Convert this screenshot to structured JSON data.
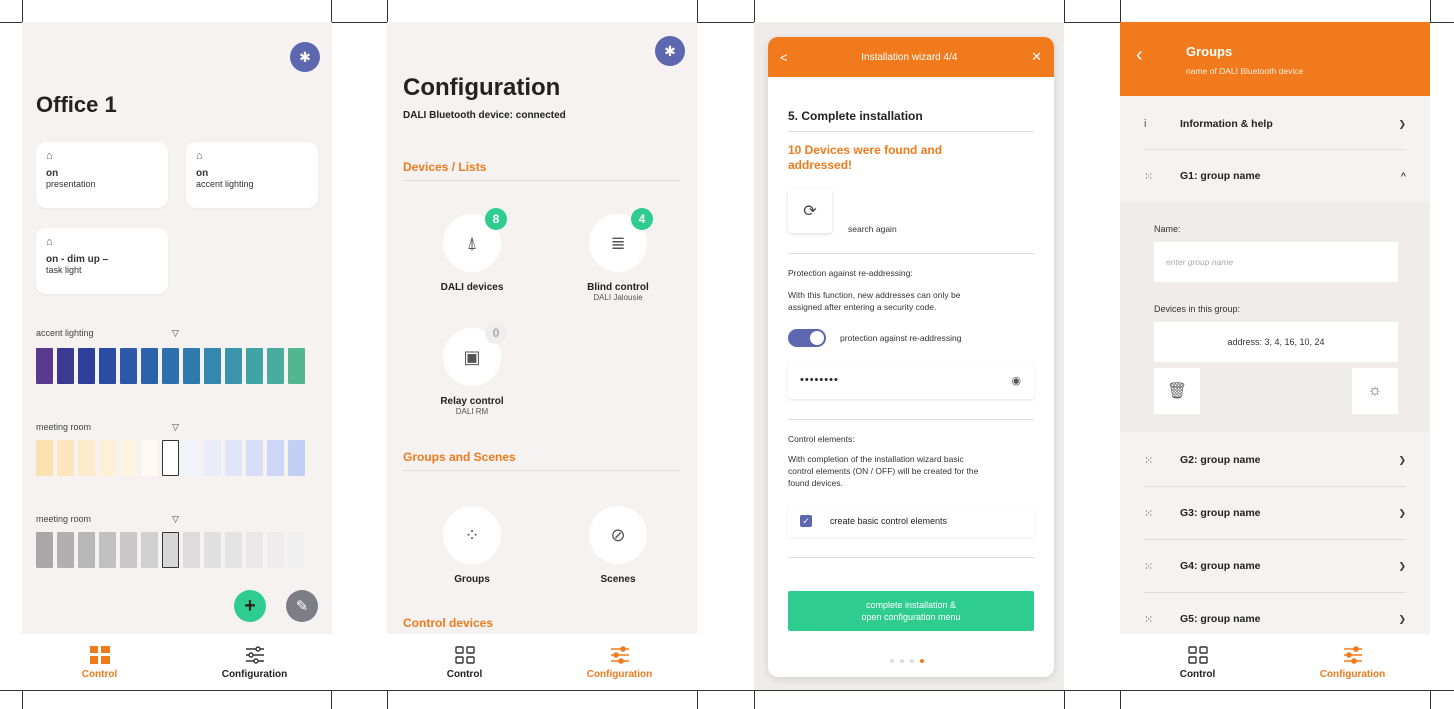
{
  "colors": {
    "accent": "#f07a1c",
    "green": "#2ecc8e",
    "indigo": "#5c67b0"
  },
  "screen1": {
    "title": "Office 1",
    "cards": [
      {
        "state": "on",
        "label": "presentation"
      },
      {
        "state": "on",
        "label": "accent lighting"
      },
      {
        "state": "on -  dim up –",
        "label": "task light"
      }
    ],
    "scenes": [
      {
        "label": "accent lighting",
        "marker": "▽"
      },
      {
        "label": "meeting room",
        "marker": "▽"
      },
      {
        "label": "meeting room",
        "marker": "▽"
      }
    ],
    "fab_add": "+",
    "fab_edit": "✎",
    "nav": {
      "control": "Control",
      "configuration": "Configuration"
    }
  },
  "screen2": {
    "title": "Configuration",
    "subtitle": "DALI Bluetooth device: connected",
    "sections": {
      "devices": "Devices / Lists",
      "groups": "Groups and Scenes",
      "control": "Control devices"
    },
    "devices": [
      {
        "name": "DALI devices",
        "sub": "",
        "count": "8"
      },
      {
        "name": "Blind control",
        "sub": "DALI Jalousie",
        "count": "4"
      },
      {
        "name": "Relay control",
        "sub": "DALI RM",
        "count": "0"
      }
    ],
    "groups_label": "Groups",
    "scenes_label": "Scenes",
    "nav": {
      "control": "Control",
      "configuration": "Configuration"
    }
  },
  "screen3": {
    "header": "Installation wizard 4/4",
    "back": "<",
    "close": "✕",
    "step": "5. Complete installation",
    "found_line1": "10 Devices were  found and",
    "found_line2": "addressed!",
    "search_again": "search again",
    "protection_title": "Protection against re-addressing:",
    "protection_desc1": "With this function, new addresses can only be",
    "protection_desc2": "assigned after entering a security code.",
    "toggle_label": "protection against re-addressing",
    "password": "••••••••",
    "control_title": "Control elements:",
    "control_desc1": "With completion of the installation wizard basic",
    "control_desc2": "control elements (ON / OFF) will be created for the",
    "control_desc3": "found devices.",
    "checkbox_label": "create basic control elements",
    "cta_line1": "complete installation &",
    "cta_line2": "open configuration menu"
  },
  "screen4": {
    "title": "Groups",
    "subtitle": "name of DALI Bluetooth device",
    "info": "Information & help",
    "g1": "G1: group name",
    "name_label": "Name:",
    "name_placeholder": "enter group name",
    "devices_label": "Devices in this group:",
    "devices_value": "address: 3, 4, 16, 10, 24",
    "groups": [
      "G2: group name",
      "G3: group name",
      "G4: group name",
      "G5: group name"
    ],
    "nav": {
      "control": "Control",
      "configuration": "Configuration"
    }
  }
}
